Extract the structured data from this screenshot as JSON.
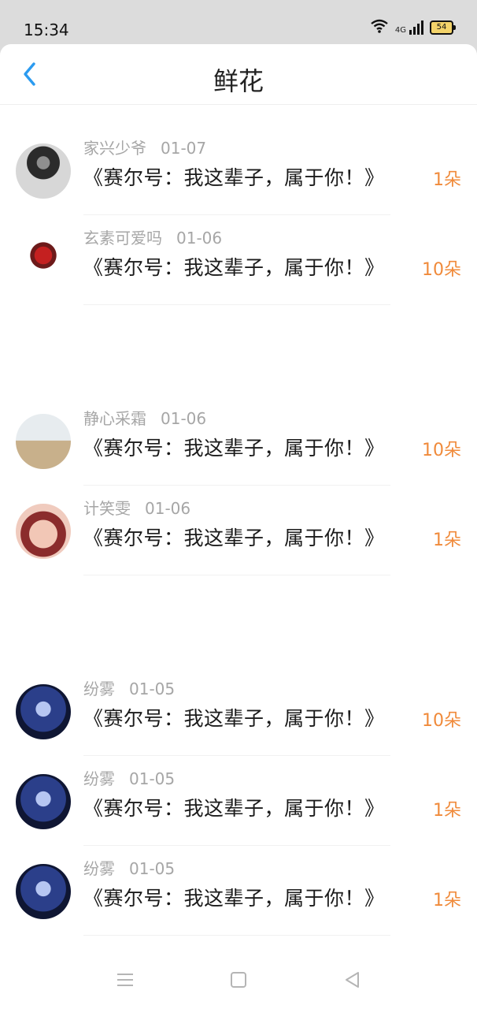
{
  "status": {
    "time": "15:34",
    "network": "4G",
    "battery": "54"
  },
  "header": {
    "title": "鲜花"
  },
  "items": [
    {
      "user": "家兴少爷",
      "date": "01-07",
      "gift": "《赛尔号：我这辈子，属于你！》",
      "count": "1朵",
      "avatar": "avatar-photo-seated"
    },
    {
      "user": "玄素可爱吗",
      "date": "01-06",
      "gift": "《赛尔号：我这辈子，属于你！》",
      "count": "10朵",
      "avatar": "avatar-red-robot"
    },
    {
      "user": "静心采霜",
      "date": "01-06",
      "gift": "《赛尔号：我这辈子，属于你！》",
      "count": "10朵",
      "avatar": "avatar-beach"
    },
    {
      "user": "计笑雯",
      "date": "01-06",
      "gift": "《赛尔号：我这辈子，属于你！》",
      "count": "1朵",
      "avatar": "avatar-anime-face"
    },
    {
      "user": "纷雾",
      "date": "01-05",
      "gift": "《赛尔号：我这辈子，属于你！》",
      "count": "10朵",
      "avatar": "avatar-blue-anime"
    },
    {
      "user": "纷雾",
      "date": "01-05",
      "gift": "《赛尔号：我这辈子，属于你！》",
      "count": "1朵",
      "avatar": "avatar-blue-anime"
    },
    {
      "user": "纷雾",
      "date": "01-05",
      "gift": "《赛尔号：我这辈子，属于你！》",
      "count": "1朵",
      "avatar": "avatar-blue-anime"
    }
  ],
  "colors": {
    "accent": "#2b9bf0",
    "count": "#f08a3a",
    "meta": "#a6a6a6"
  }
}
